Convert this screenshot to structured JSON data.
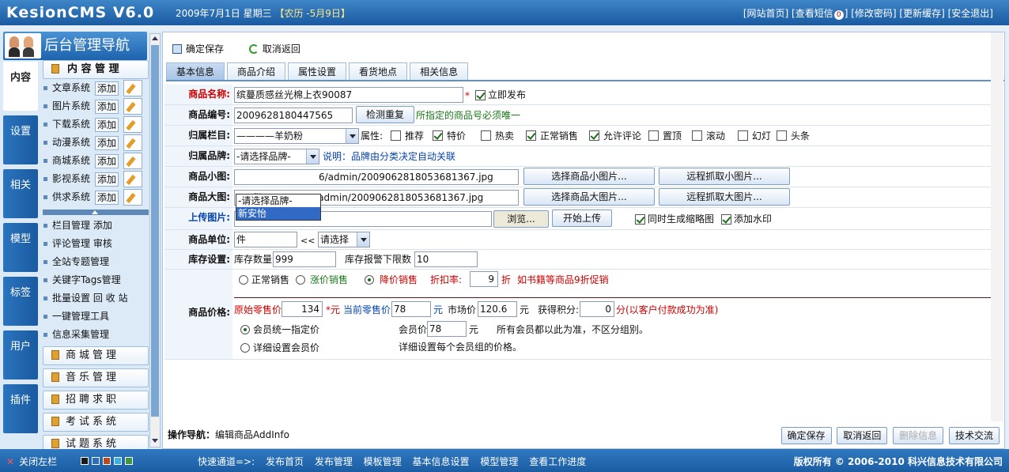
{
  "header": {
    "logo": "KesionCMS V6.0",
    "date": "2009年7月1日 星期三",
    "lunar": "【农历 -5月9日】",
    "links": [
      "[网站首页]",
      "[查看短信",
      "]",
      "[修改密码]",
      "[更新缓存]",
      "[安全退出]"
    ],
    "msg_count": "0"
  },
  "nav": {
    "title": "后台管理导航",
    "vtabs": [
      "内容",
      "设置",
      "相关",
      "模型",
      "标签",
      "用户",
      "插件"
    ],
    "content_head": "内 容 管 理",
    "systems": [
      "文章系统",
      "图片系统",
      "下载系统",
      "动漫系统",
      "商城系统",
      "影视系统",
      "供求系统"
    ],
    "add_label": "添加",
    "links": [
      "栏目管理 添加",
      "评论管理 审核",
      "全站专题管理",
      "关键字Tags管理",
      "批量设置 回 收 站",
      "一键管理工具",
      "信息采集管理"
    ],
    "sections": [
      "商城管理",
      "音乐管理",
      "招聘求职",
      "考试系统",
      "试题系统"
    ]
  },
  "toolbar": {
    "save": "确定保存",
    "back": "取消返回"
  },
  "tabs": [
    "基本信息",
    "商品介绍",
    "属性设置",
    "看货地点",
    "相关信息"
  ],
  "form": {
    "name_label": "商品名称:",
    "name_value": "缤蔓质感丝光棉上衣90087",
    "required_mark": "*",
    "publish_label": "立即发布",
    "code_label": "商品编号:",
    "code_value": "2009628180447565",
    "check_btn": "检测重复",
    "code_hint": "所指定的商品号必须唯一",
    "category_label": "归属栏目:",
    "category_value": "————羊奶粉",
    "attr_label": "属性:",
    "attrs": [
      {
        "label": "推荐",
        "checked": false
      },
      {
        "label": "特价",
        "checked": true
      },
      {
        "label": "热卖",
        "checked": false
      },
      {
        "label": "正常销售",
        "checked": true
      },
      {
        "label": "允许评论",
        "checked": true
      },
      {
        "label": "置顶",
        "checked": false
      },
      {
        "label": "滚动",
        "checked": false
      },
      {
        "label": "幻灯",
        "checked": false
      },
      {
        "label": "头条",
        "checked": false
      }
    ],
    "brand_label": "归属品牌:",
    "brand_value": "-请选择品牌-",
    "brand_hint": "说明：品牌由分类决定自动关联",
    "brand_options": [
      "-请选择品牌-",
      "新安怡"
    ],
    "small_pic_label": "商品小图:",
    "small_pic_value": "6/admin/2009062818053681367.jpg",
    "small_pic_btn1": "选择商品小图片...",
    "small_pic_btn2": "远程抓取小图片...",
    "big_pic_label": "商品大图:",
    "big_pic_value": "/Upfiles/2009-06/admin/2009062818053681367.jpg",
    "big_pic_btn1": "选择商品大图片...",
    "big_pic_btn2": "远程抓取大图片...",
    "upload_label": "上传图片:",
    "browse_btn": "浏览...",
    "upload_btn": "开始上传",
    "thumb_label": "同时生成缩略图",
    "watermark_label": "添加水印",
    "unit_label": "商品单位:",
    "unit_value": "件",
    "unit_arrow": "<<",
    "unit_select": "请选择",
    "stock_label": "库存设置:",
    "stock_qty_label": "库存数量",
    "stock_qty": "999",
    "stock_alert_label": "库存报警下限数",
    "stock_alert": "10",
    "price_label": "商品价格:",
    "sale_types": [
      "正常销售",
      "涨价销售",
      "降价销售"
    ],
    "discount_label": "折扣率:",
    "discount_value": "9",
    "discount_unit": "折",
    "discount_hint": "如书籍等商品9折促销",
    "orig_price_label": "原始零售价",
    "orig_price": "134",
    "orig_unit": "*元",
    "cur_price_label": "当前零售价",
    "cur_price": "78",
    "cur_unit": "元",
    "market_label": "市场价",
    "market_price": "120.6",
    "market_unit": "元",
    "points_label": "获得积分:",
    "points": "0",
    "points_hint": "分(以客户付款成功为准)",
    "member_unified": "会员统一指定价",
    "member_price_label": "会员价",
    "member_price": "78",
    "member_unit": "元",
    "member_hint": "所有会员都以此为准，不区分组别。",
    "member_detail": "详细设置会员价",
    "member_detail_hint": "详细设置每个会员组的价格。"
  },
  "footer_bar": {
    "op_label": "操作导航：",
    "op_value": "编辑商品AddInfo",
    "buttons": [
      "确定保存",
      "取消返回",
      "删除信息",
      "技术交流"
    ]
  },
  "statusbar": {
    "close_label": "关闭左栏",
    "quick_label": "快速通道=>:",
    "quick_links": [
      "发布首页",
      "发布管理",
      "模板管理",
      "基本信息设置",
      "模型管理",
      "查看工作进度"
    ],
    "copyright": "版权所有 © 2006-2010 科兴信息技术有限公司",
    "swatches": [
      "#1a1a1a",
      "#2a6fba",
      "#b84c1e",
      "#3ab0e8",
      "#3a9a3a"
    ]
  }
}
